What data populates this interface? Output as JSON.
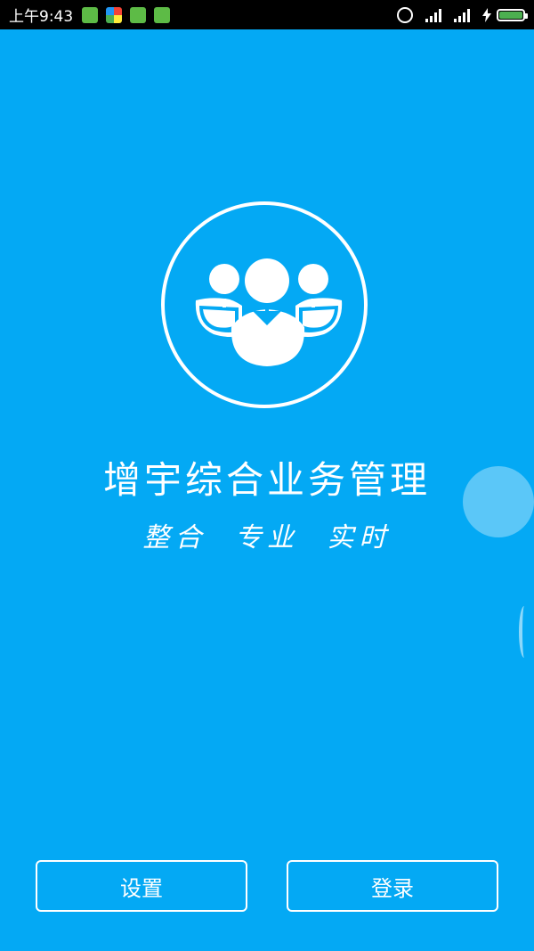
{
  "status_bar": {
    "time": "上午9:43",
    "battery_color": "#4caf50"
  },
  "app": {
    "title": "增宇综合业务管理",
    "slogan": "整合 专业 实时"
  },
  "buttons": {
    "settings_label": "设置",
    "login_label": "登录"
  },
  "colors": {
    "background": "#04a9f4",
    "foreground": "#ffffff"
  }
}
